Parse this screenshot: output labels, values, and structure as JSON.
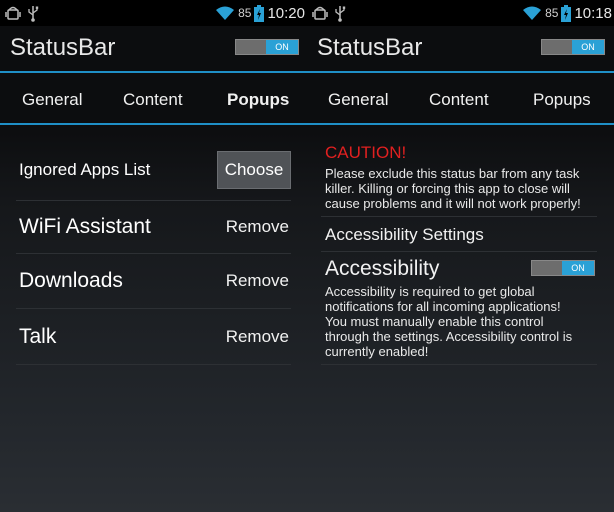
{
  "left": {
    "status": {
      "battery": "85",
      "time": "10:20"
    },
    "title": "StatusBar",
    "toggle_label": "ON",
    "tabs": [
      "General",
      "Content",
      "Popups"
    ],
    "active_tab": "Popups",
    "ignored_label": "Ignored Apps List",
    "choose_label": "Choose",
    "apps": [
      {
        "name": "WiFi Assistant",
        "action": "Remove"
      },
      {
        "name": "Downloads",
        "action": "Remove"
      },
      {
        "name": "Talk",
        "action": "Remove"
      }
    ]
  },
  "right": {
    "status": {
      "battery": "85",
      "time": "10:18"
    },
    "title": "StatusBar",
    "toggle_label": "ON",
    "tabs": [
      "General",
      "Content",
      "Popups"
    ],
    "caution_title": "CAUTION!",
    "caution_lines": [
      "Please exclude this status bar from any task",
      "killer. Killing or forcing this app to close will",
      "cause problems and it will not work properly!"
    ],
    "accessibility_settings": "Accessibility Settings",
    "accessibility_title": "Accessibility",
    "accessibility_toggle": "ON",
    "accessibility_lines": [
      "Accessibility is required to get global",
      "notifications for all incoming applications!",
      "You must manually enable this control",
      "through the settings. Accessibility control is",
      "currently enabled!"
    ]
  },
  "colors": {
    "accent": "#2aa1d6",
    "divider": "#1f8fc7",
    "caution": "#e02020"
  },
  "icons": [
    "android-debug-icon",
    "usb-icon",
    "wifi-icon",
    "battery-charging-icon"
  ]
}
